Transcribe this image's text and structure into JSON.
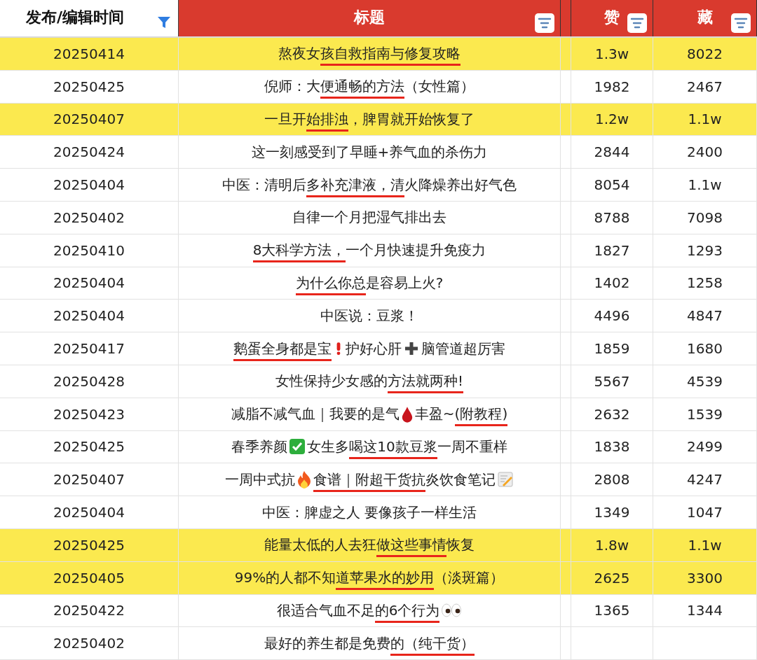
{
  "table": {
    "columns": [
      {
        "label": "发布/编辑时间"
      },
      {
        "label": "标题"
      },
      {
        "label": "赞"
      },
      {
        "label": "藏"
      }
    ],
    "rows": [
      {
        "highlighted": true,
        "date": "20250414",
        "likes": "1.3w",
        "saves": "8022",
        "title": [
          {
            "kind": "text",
            "text": "熬夜女",
            "underlined": false
          },
          {
            "kind": "text",
            "text": "孩自救指南与修复攻略",
            "underlined": true
          }
        ]
      },
      {
        "highlighted": false,
        "date": "20250425",
        "likes": "1982",
        "saves": "2467",
        "title": [
          {
            "kind": "text",
            "text": "倪师：大",
            "underlined": false
          },
          {
            "kind": "text",
            "text": "便通畅的方法",
            "underlined": true
          },
          {
            "kind": "text",
            "text": "（女性篇）",
            "underlined": false
          }
        ]
      },
      {
        "highlighted": true,
        "date": "20250407",
        "likes": "1.2w",
        "saves": "1.1w",
        "title": [
          {
            "kind": "text",
            "text": "一旦开",
            "underlined": false
          },
          {
            "kind": "text",
            "text": "始排浊",
            "underlined": true
          },
          {
            "kind": "text",
            "text": "，脾胃就开始恢复了",
            "underlined": false
          }
        ]
      },
      {
        "highlighted": false,
        "date": "20250424",
        "likes": "2844",
        "saves": "2400",
        "title": [
          {
            "kind": "text",
            "text": "这一刻感受到了早睡+养气血的杀伤力",
            "underlined": false
          }
        ]
      },
      {
        "highlighted": false,
        "date": "20250404",
        "likes": "8054",
        "saves": "1.1w",
        "title": [
          {
            "kind": "text",
            "text": "中医：清明后",
            "underlined": false
          },
          {
            "kind": "text",
            "text": "多补充津液，清",
            "underlined": true
          },
          {
            "kind": "text",
            "text": "火降燥养出好气色",
            "underlined": false
          }
        ]
      },
      {
        "highlighted": false,
        "date": "20250402",
        "likes": "8788",
        "saves": "7098",
        "title": [
          {
            "kind": "text",
            "text": "自律一个月把湿气排出去",
            "underlined": false
          }
        ]
      },
      {
        "highlighted": false,
        "date": "20250410",
        "likes": "1827",
        "saves": "1293",
        "title": [
          {
            "kind": "text",
            "text": "8大科学方法，",
            "underlined": true
          },
          {
            "kind": "text",
            "text": "一个月快速提升免疫力",
            "underlined": false
          }
        ]
      },
      {
        "highlighted": false,
        "date": "20250404",
        "likes": "1402",
        "saves": "1258",
        "title": [
          {
            "kind": "text",
            "text": "为什么你总",
            "underlined": true
          },
          {
            "kind": "text",
            "text": "是容易上火?",
            "underlined": false
          }
        ]
      },
      {
        "highlighted": false,
        "date": "20250404",
        "likes": "4496",
        "saves": "4847",
        "title": [
          {
            "kind": "text",
            "text": "中医说：豆浆！",
            "underlined": false
          }
        ]
      },
      {
        "highlighted": false,
        "date": "20250417",
        "likes": "1859",
        "saves": "1680",
        "title": [
          {
            "kind": "text",
            "text": "鹅蛋全身都是宝",
            "underlined": true
          },
          {
            "kind": "exclamation"
          },
          {
            "kind": "text",
            "text": "护好心肝",
            "underlined": false
          },
          {
            "kind": "plus"
          },
          {
            "kind": "text",
            "text": "脑管道超厉害",
            "underlined": false
          }
        ]
      },
      {
        "highlighted": false,
        "date": "20250428",
        "likes": "5567",
        "saves": "4539",
        "title": [
          {
            "kind": "text",
            "text": "女性保持少女感的",
            "underlined": false
          },
          {
            "kind": "text",
            "text": "方法就两种!",
            "underlined": true
          }
        ]
      },
      {
        "highlighted": false,
        "date": "20250423",
        "likes": "2632",
        "saves": "1539",
        "title": [
          {
            "kind": "text",
            "text": "减脂不减气血｜我要的是气",
            "underlined": false
          },
          {
            "kind": "drop"
          },
          {
            "kind": "text",
            "text": "丰盈~",
            "underlined": false
          },
          {
            "kind": "text",
            "text": "(附教程)",
            "underlined": true
          }
        ]
      },
      {
        "highlighted": false,
        "date": "20250425",
        "likes": "1838",
        "saves": "2499",
        "title": [
          {
            "kind": "text",
            "text": "春季养颜",
            "underlined": false
          },
          {
            "kind": "check"
          },
          {
            "kind": "text",
            "text": "女生多",
            "underlined": false
          },
          {
            "kind": "text",
            "text": "喝这10款豆浆",
            "underlined": true
          },
          {
            "kind": "text",
            "text": "一周不重样",
            "underlined": false
          }
        ]
      },
      {
        "highlighted": false,
        "date": "20250407",
        "likes": "2808",
        "saves": "4247",
        "title": [
          {
            "kind": "text",
            "text": "一周中式抗",
            "underlined": false
          },
          {
            "kind": "fire"
          },
          {
            "kind": "text",
            "text": "食谱｜",
            "underlined": true
          },
          {
            "kind": "text",
            "text": "附超干货抗",
            "underlined": true
          },
          {
            "kind": "text",
            "text": "炎饮食笔记",
            "underlined": false
          },
          {
            "kind": "memo"
          }
        ]
      },
      {
        "highlighted": false,
        "date": "20250404",
        "likes": "1349",
        "saves": "1047",
        "title": [
          {
            "kind": "text",
            "text": "中医：脾虚之人 要像孩子一样生活",
            "underlined": false
          }
        ]
      },
      {
        "highlighted": true,
        "date": "20250425",
        "likes": "1.8w",
        "saves": "1.1w",
        "title": [
          {
            "kind": "text",
            "text": "能量太低的人去狂",
            "underlined": false
          },
          {
            "kind": "text",
            "text": "做这些事情",
            "underlined": true
          },
          {
            "kind": "text",
            "text": "恢复",
            "underlined": false
          }
        ]
      },
      {
        "highlighted": true,
        "date": "20250405",
        "likes": "2625",
        "saves": "3300",
        "title": [
          {
            "kind": "text",
            "text": "99%的人都不知",
            "underlined": false
          },
          {
            "kind": "text",
            "text": "道苹果水的妙用",
            "underlined": true
          },
          {
            "kind": "text",
            "text": "（淡斑篇）",
            "underlined": false
          }
        ]
      },
      {
        "highlighted": false,
        "date": "20250422",
        "likes": "1365",
        "saves": "1344",
        "title": [
          {
            "kind": "text",
            "text": "很适合气血不足",
            "underlined": false
          },
          {
            "kind": "text",
            "text": "的6个行为",
            "underlined": true
          },
          {
            "kind": "eyes"
          }
        ]
      },
      {
        "highlighted": false,
        "date": "20250402",
        "title": [
          {
            "kind": "text",
            "text": "最好的养生都是免费",
            "underlined": false
          },
          {
            "kind": "text",
            "text": "的（纯干货）",
            "underlined": true
          }
        ]
      }
    ]
  }
}
